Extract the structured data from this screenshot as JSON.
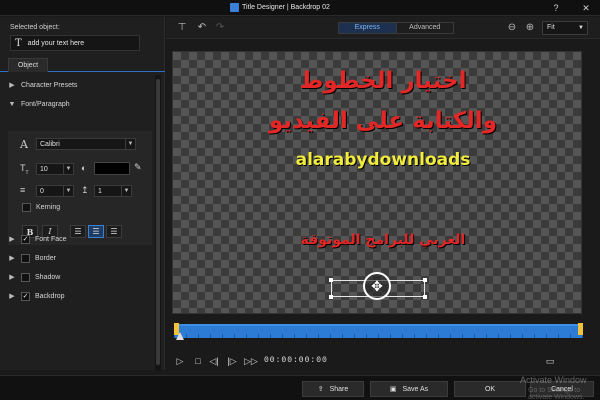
{
  "window": {
    "title": "Title Designer  |  Backdrop 02",
    "help_icon": "help-icon",
    "close_icon": "close-icon"
  },
  "left_panel": {
    "selected_object_label": "Selected object:",
    "selected_object_value": "add your text here",
    "tabs": [
      {
        "label": "Object"
      }
    ],
    "sections": [
      {
        "label": "Character Presets",
        "expanded": false,
        "checkbox": false
      },
      {
        "label": "Font/Paragraph",
        "expanded": true,
        "checkbox": false
      },
      {
        "label": "Font Face",
        "expanded": false,
        "checkbox": true,
        "checked": true
      },
      {
        "label": "Border",
        "expanded": false,
        "checkbox": true,
        "checked": false
      },
      {
        "label": "Shadow",
        "expanded": false,
        "checkbox": true,
        "checked": false
      },
      {
        "label": "Backdrop",
        "expanded": false,
        "checkbox": true,
        "checked": true
      }
    ],
    "font_paragraph": {
      "font_name": "Calibri",
      "font_size": "10",
      "font_color": "#000000",
      "line_spacing": "0",
      "char_spacing": "1",
      "kerning_label": "Kerning",
      "kerning_checked": false,
      "bold_label": "B",
      "italic_label": "I",
      "alignment": "center"
    }
  },
  "toolbar": {
    "modes": [
      {
        "label": "Express",
        "active": true
      },
      {
        "label": "Advanced",
        "active": false
      }
    ],
    "zoom_value": "Fit"
  },
  "canvas": {
    "line1": "اختيار الخطوط",
    "line2": "والكتابة على الفيديو",
    "line3": "alarabydownloads",
    "line4": "العربي للبرامج الموثوقة",
    "text_color_red": "#e32626",
    "text_color_yellow": "#f2ec3c"
  },
  "transport": {
    "timecode": "00:00:00:00"
  },
  "footer": {
    "share_label": "Share",
    "save_as_label": "Save As",
    "ok_label": "OK",
    "cancel_label": "Cancel",
    "watermark_line1": "Activate Window",
    "watermark_line2": "Go to Settings to activate Windows."
  }
}
